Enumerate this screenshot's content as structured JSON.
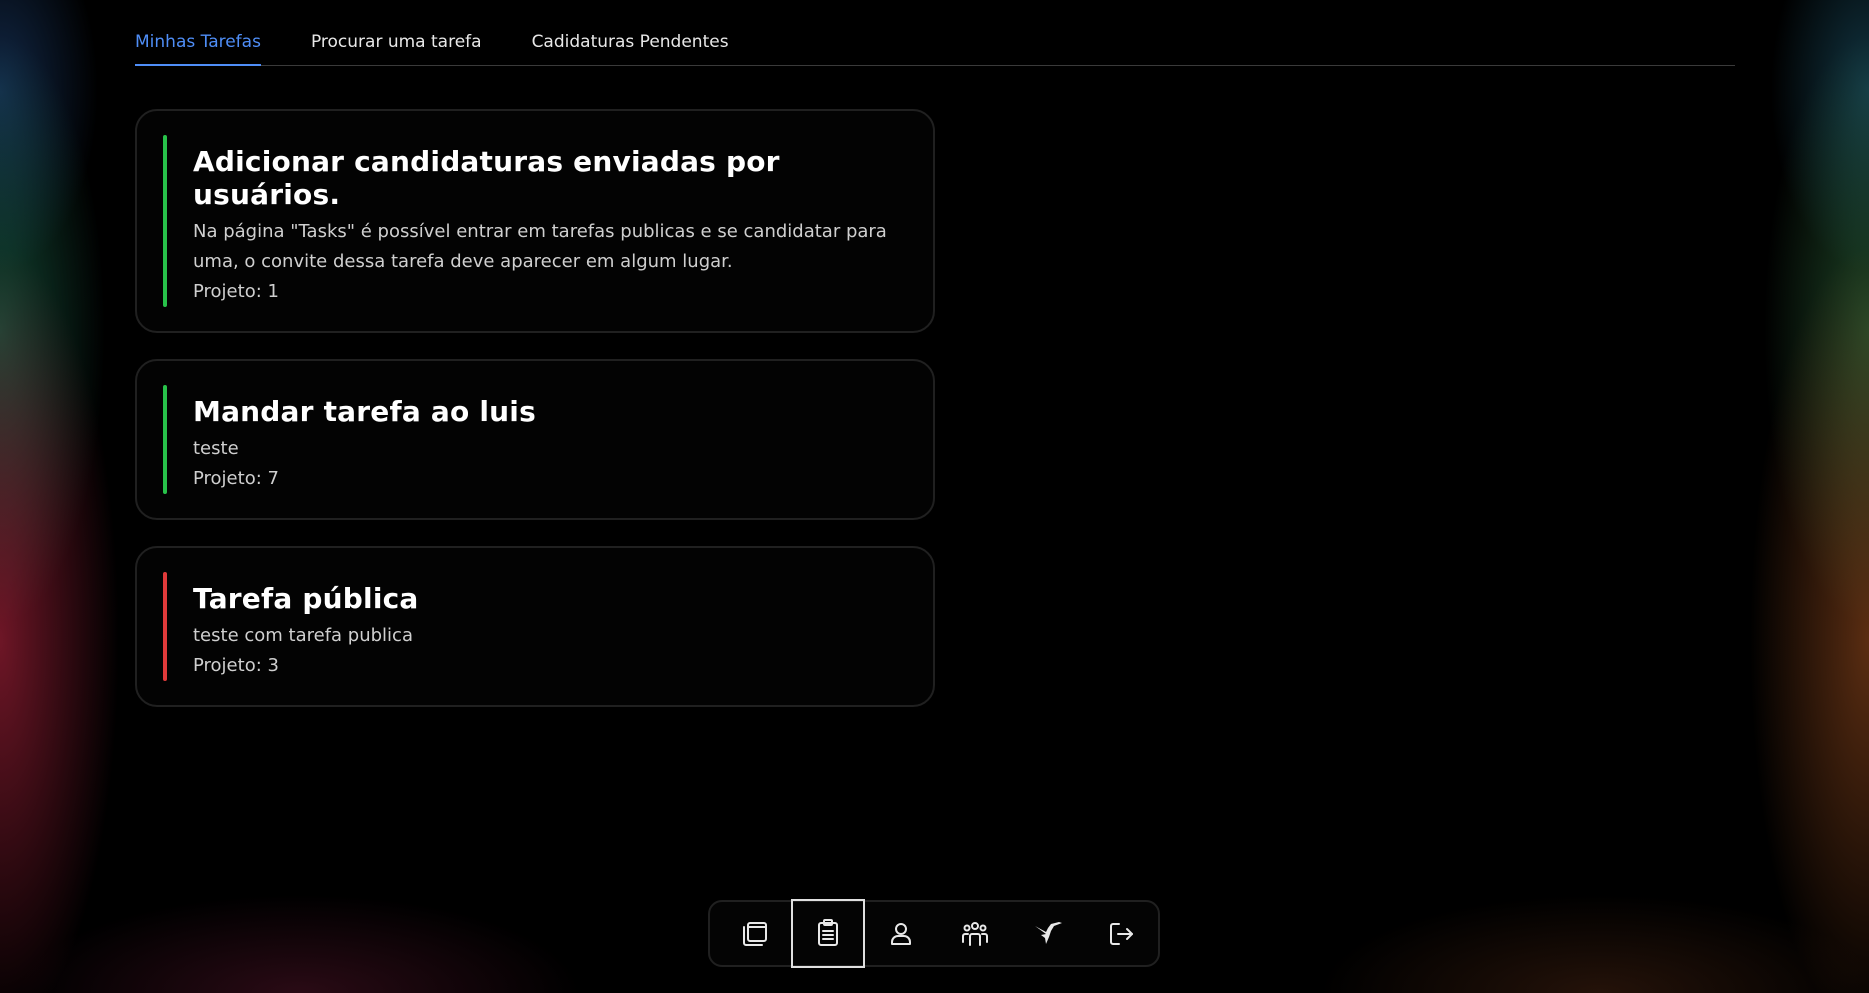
{
  "tabs": [
    {
      "label": "Minhas Tarefas",
      "active": true
    },
    {
      "label": "Procurar uma tarefa",
      "active": false
    },
    {
      "label": "Cadidaturas Pendentes",
      "active": false
    }
  ],
  "tasks": [
    {
      "title": "Adicionar candidaturas enviadas por usuários.",
      "description": "Na página \"Tasks\" é possível entrar em tarefas publicas e se candidatar para uma, o convite dessa tarefa deve aparecer em algum lugar.",
      "project": "Projeto: 1",
      "status_color": "#28c24a"
    },
    {
      "title": "Mandar tarefa ao luis",
      "description": "teste",
      "project": "Projeto: 7",
      "status_color": "#28c24a"
    },
    {
      "title": "Tarefa pública",
      "description": "teste com tarefa publica",
      "project": "Projeto: 3",
      "status_color": "#e03a3a"
    }
  ],
  "dock": {
    "items": [
      {
        "icon": "projects-icon",
        "active": false
      },
      {
        "icon": "clipboard-icon",
        "active": true
      },
      {
        "icon": "user-icon",
        "active": false
      },
      {
        "icon": "team-icon",
        "active": false
      },
      {
        "icon": "hummingbird-logo-icon",
        "active": false
      },
      {
        "icon": "logout-icon",
        "active": false
      }
    ]
  },
  "colors": {
    "accent": "#4f8ef7",
    "background": "#000000"
  }
}
